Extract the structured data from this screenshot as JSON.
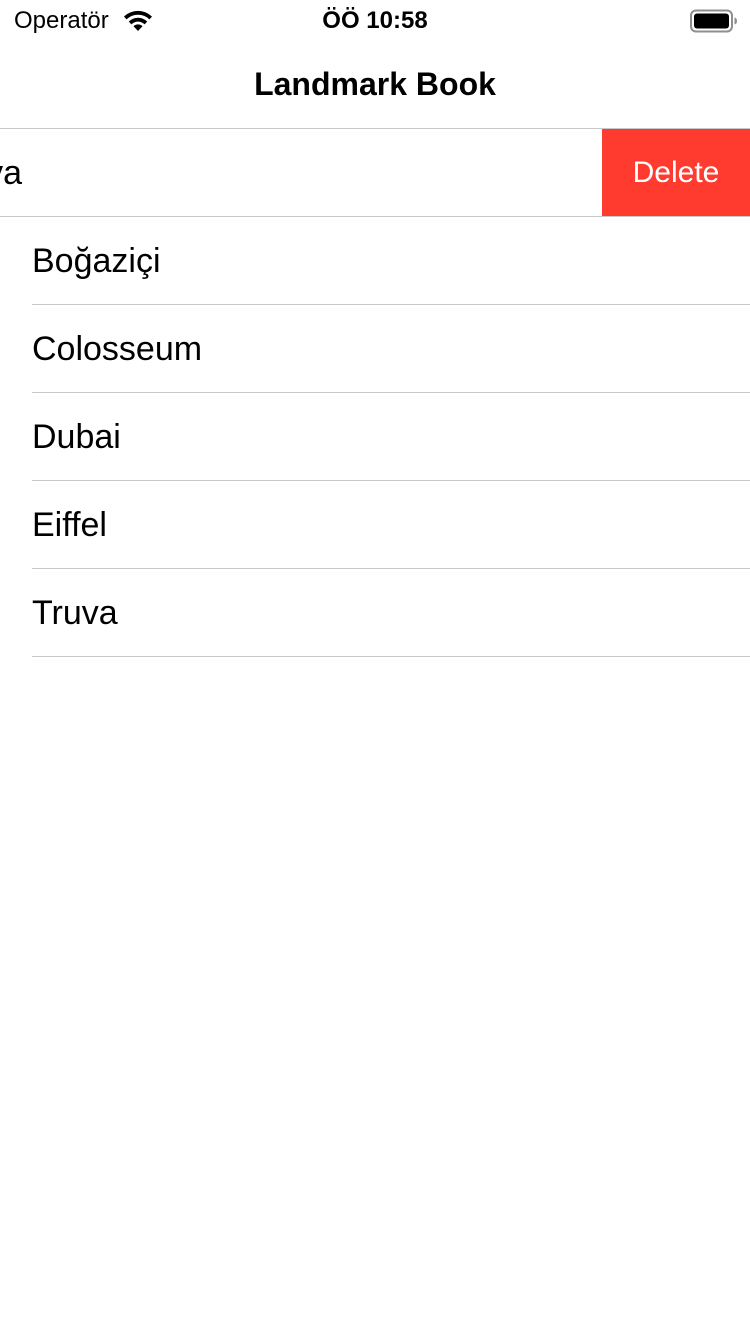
{
  "status_bar": {
    "carrier": "Operatör",
    "time": "ÖÖ 10:58",
    "wifi_icon": "wifi-icon",
    "battery_icon": "battery-icon"
  },
  "nav": {
    "title": "Landmark Book"
  },
  "table": {
    "swiped_row": {
      "visible_text": "va",
      "delete_label": "Delete",
      "delete_color": "#ff3b30"
    },
    "rows": [
      {
        "label": "Boğaziçi"
      },
      {
        "label": "Colosseum"
      },
      {
        "label": "Dubai"
      },
      {
        "label": "Eiffel"
      },
      {
        "label": "Truva"
      }
    ]
  }
}
